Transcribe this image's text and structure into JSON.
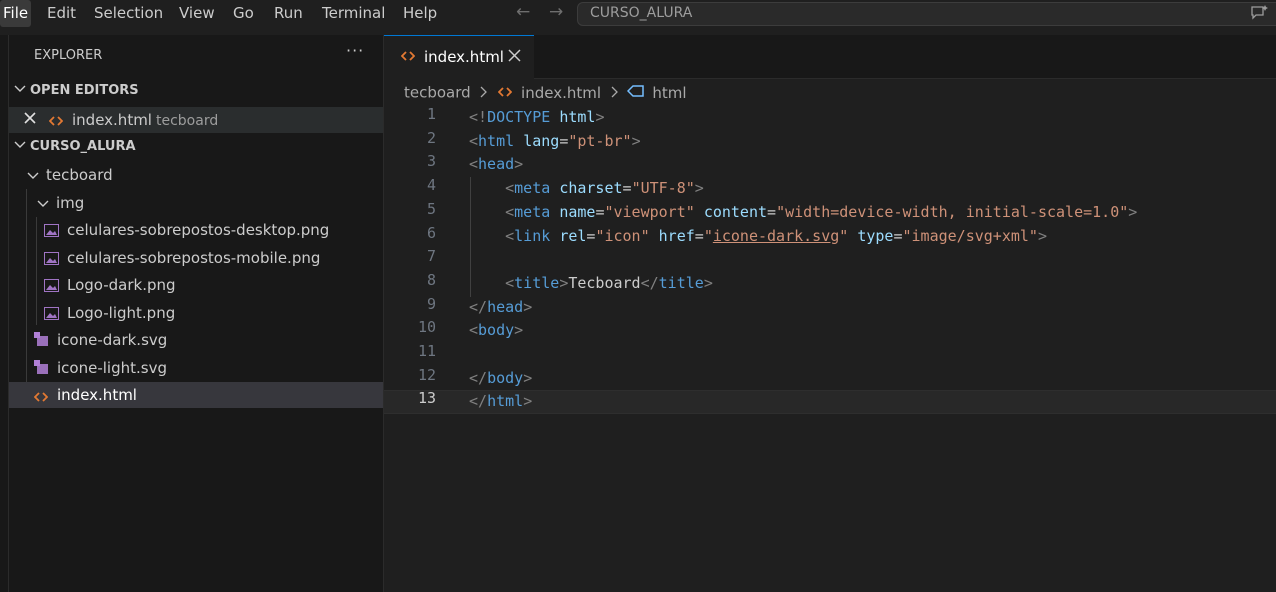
{
  "menu": [
    "File",
    "Edit",
    "Selection",
    "View",
    "Go",
    "Run",
    "Terminal",
    "Help"
  ],
  "search": {
    "text": "CURSO_ALURA"
  },
  "sidebar": {
    "title": "EXPLORER",
    "open_editors_header": "OPEN EDITORS",
    "open_editor": {
      "name": "index.html",
      "folder": "tecboard"
    },
    "workspace_header": "CURSO_ALURA",
    "tree": {
      "folder_tecboard": "tecboard",
      "folder_img": "img",
      "img_files": [
        "celulares-sobrepostos-desktop.png",
        "celulares-sobrepostos-mobile.png",
        "Logo-dark.png",
        "Logo-light.png"
      ],
      "files": [
        "icone-dark.svg",
        "icone-light.svg",
        "index.html"
      ]
    }
  },
  "tab": {
    "label": "index.html"
  },
  "breadcrumb": {
    "folder": "tecboard",
    "file": "index.html",
    "symbol": "html"
  },
  "editor": {
    "current_line": 13,
    "line_numbers": [
      "1",
      "2",
      "3",
      "4",
      "5",
      "6",
      "7",
      "8",
      "9",
      "10",
      "11",
      "12",
      "13"
    ],
    "lines": [
      [
        [
          "tk-punct",
          "<!"
        ],
        [
          "tk-tag",
          "DOCTYPE "
        ],
        [
          "tk-attr",
          "html"
        ],
        [
          "tk-punct",
          ">"
        ]
      ],
      [
        [
          "tk-punct",
          "<"
        ],
        [
          "tk-tag",
          "html "
        ],
        [
          "tk-attr",
          "lang"
        ],
        [
          "tk-text",
          "="
        ],
        [
          "tk-str",
          "\"pt-br\""
        ],
        [
          "tk-punct",
          ">"
        ]
      ],
      [
        [
          "tk-punct",
          "<"
        ],
        [
          "tk-tag",
          "head"
        ],
        [
          "tk-punct",
          ">"
        ]
      ],
      [
        [
          "tk-text",
          "    "
        ],
        [
          "tk-punct",
          "<"
        ],
        [
          "tk-tag",
          "meta "
        ],
        [
          "tk-attr",
          "charset"
        ],
        [
          "tk-text",
          "="
        ],
        [
          "tk-str",
          "\"UTF-8\""
        ],
        [
          "tk-punct",
          ">"
        ]
      ],
      [
        [
          "tk-text",
          "    "
        ],
        [
          "tk-punct",
          "<"
        ],
        [
          "tk-tag",
          "meta "
        ],
        [
          "tk-attr",
          "name"
        ],
        [
          "tk-text",
          "="
        ],
        [
          "tk-str",
          "\"viewport\" "
        ],
        [
          "tk-attr",
          "content"
        ],
        [
          "tk-text",
          "="
        ],
        [
          "tk-str",
          "\"width=device-width, initial-scale=1.0\""
        ],
        [
          "tk-punct",
          ">"
        ]
      ],
      [
        [
          "tk-text",
          "    "
        ],
        [
          "tk-punct",
          "<"
        ],
        [
          "tk-tag",
          "link "
        ],
        [
          "tk-attr",
          "rel"
        ],
        [
          "tk-text",
          "="
        ],
        [
          "tk-str",
          "\"icon\" "
        ],
        [
          "tk-attr",
          "href"
        ],
        [
          "tk-text",
          "="
        ],
        [
          "tk-str",
          "\""
        ],
        [
          "tk-link",
          "icone-dark.svg"
        ],
        [
          "tk-str",
          "\" "
        ],
        [
          "tk-attr",
          "type"
        ],
        [
          "tk-text",
          "="
        ],
        [
          "tk-str",
          "\"image/svg+xml\""
        ],
        [
          "tk-punct",
          ">"
        ]
      ],
      [],
      [
        [
          "tk-text",
          "    "
        ],
        [
          "tk-punct",
          "<"
        ],
        [
          "tk-tag",
          "title"
        ],
        [
          "tk-punct",
          ">"
        ],
        [
          "tk-text",
          "Tecboard"
        ],
        [
          "tk-punct",
          "</"
        ],
        [
          "tk-tag",
          "title"
        ],
        [
          "tk-punct",
          ">"
        ]
      ],
      [
        [
          "tk-punct",
          "</"
        ],
        [
          "tk-tag",
          "head"
        ],
        [
          "tk-punct",
          ">"
        ]
      ],
      [
        [
          "tk-punct",
          "<"
        ],
        [
          "tk-tag",
          "body"
        ],
        [
          "tk-punct",
          ">"
        ]
      ],
      [],
      [
        [
          "tk-punct",
          "</"
        ],
        [
          "tk-tag",
          "body"
        ],
        [
          "tk-punct",
          ">"
        ]
      ],
      [
        [
          "tk-punct",
          "</"
        ],
        [
          "tk-tag",
          "html"
        ],
        [
          "tk-punct",
          ">"
        ]
      ]
    ]
  },
  "colors": {
    "accent": "#0078d4",
    "html_icon": "#e37933",
    "image_icon": "#a074c4",
    "svg_icon": "#b180d7"
  },
  "icons": {
    "chat": "chat-sparkle-icon",
    "more": "ellipsis-icon",
    "close": "close-icon"
  }
}
